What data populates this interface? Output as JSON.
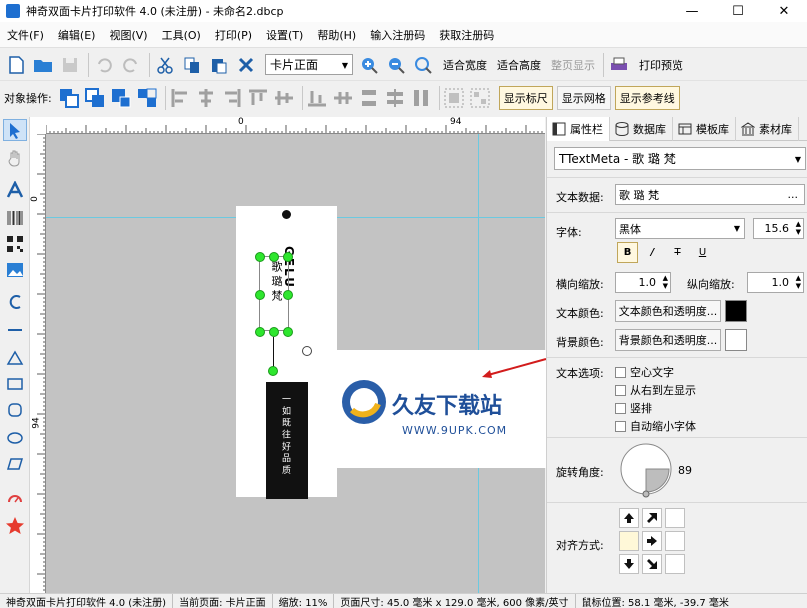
{
  "window": {
    "title": "神奇双面卡片打印软件 4.0 (未注册) - 未命名2.dbcp",
    "controls": [
      "—",
      "☐",
      "✕"
    ]
  },
  "menu": [
    "文件(F)",
    "编辑(E)",
    "视图(V)",
    "工具(O)",
    "打印(P)",
    "设置(T)",
    "帮助(H)",
    "输入注册码",
    "获取注册码"
  ],
  "toolbar": {
    "side_select": "卡片正面",
    "fit_width": "适合宽度",
    "fit_height": "适合高度",
    "full_page": "整页显示",
    "print_preview": "打印预览"
  },
  "object_toolbar": {
    "label": "对象操作:",
    "show_ruler": "显示标尺",
    "show_grid": "显示网格",
    "show_guides": "显示参考线"
  },
  "ruler": {
    "top_marks": [
      "0",
      "94"
    ],
    "left_marks": [
      "0",
      "94"
    ]
  },
  "card": {
    "text_vertical": "歌 璐 梵",
    "partial_text": "GELU",
    "black_box_text": "一 如 既 往 好 品 质"
  },
  "watermark": {
    "name": "久友下载站",
    "url": "WWW.9UPK.COM"
  },
  "right_panel": {
    "tabs": [
      "属性栏",
      "数据库",
      "模板库",
      "素材库"
    ],
    "object_select": "TTextMeta - 歌 璐 梵",
    "text_data_label": "文本数据:",
    "text_data_value": "歌 璐 梵",
    "text_data_btn": "...",
    "font_label": "字体:",
    "font_value": "黑体",
    "font_size": "15.6",
    "style_buttons": [
      "B",
      "/",
      "T",
      "U"
    ],
    "h_scale_label": "横向缩放:",
    "h_scale_value": "1.0",
    "v_scale_label": "纵向缩放:",
    "v_scale_value": "1.0",
    "text_color_label": "文本颜色:",
    "text_color_btn": "文本颜色和透明度...",
    "text_color": "#000000",
    "bg_color_label": "背景颜色:",
    "bg_color_btn": "背景颜色和透明度...",
    "bg_color": "#ffffff",
    "text_options_label": "文本选项:",
    "options": [
      "空心文字",
      "从右到左显示",
      "竖排",
      "自动缩小字体"
    ],
    "rotation_label": "旋转角度:",
    "rotation_value": "89",
    "align_label": "对齐方式:"
  },
  "status": {
    "app": "神奇双面卡片打印软件 4.0 (未注册)",
    "page": "当前页面: 卡片正面",
    "zoom": "缩放: 11%",
    "size": "页面尺寸: 45.0 毫米 x 129.0 毫米, 600 像素/英寸",
    "mouse": "鼠标位置: 58.1 毫米, -39.7 毫米"
  }
}
